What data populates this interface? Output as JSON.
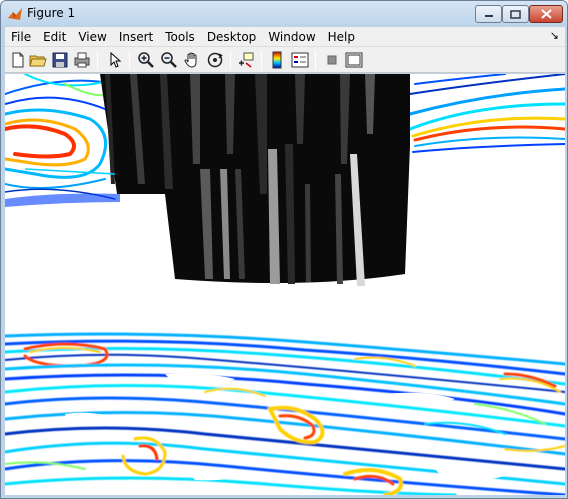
{
  "window": {
    "title": "Figure 1"
  },
  "menu": {
    "items": [
      "File",
      "Edit",
      "View",
      "Insert",
      "Tools",
      "Desktop",
      "Window",
      "Help"
    ],
    "dock_glyph": "↘"
  },
  "toolbar": {
    "tools": [
      {
        "name": "new-figure-icon"
      },
      {
        "name": "open-file-icon"
      },
      {
        "name": "save-figure-icon"
      },
      {
        "name": "print-figure-icon"
      },
      {
        "name": "edit-plot-arrow-icon"
      },
      {
        "name": "zoom-in-icon"
      },
      {
        "name": "zoom-out-icon"
      },
      {
        "name": "pan-hand-icon"
      },
      {
        "name": "rotate-3d-icon"
      },
      {
        "name": "data-cursor-icon"
      },
      {
        "name": "insert-colorbar-icon"
      },
      {
        "name": "insert-legend-icon"
      },
      {
        "name": "hide-plot-tools-icon"
      },
      {
        "name": "show-plot-tools-icon"
      }
    ]
  },
  "plot": {
    "type": "3d-surface-contour-view",
    "colormap": [
      "#00008f",
      "#0050ff",
      "#00cfff",
      "#7fff7f",
      "#ffd000",
      "#ff4000",
      "#8f0000"
    ],
    "object_color": "#000000"
  },
  "colors": {
    "titlebar": "#bcd3ea",
    "menubar": "#f0f0f0",
    "axes_background": "#ffffff"
  }
}
